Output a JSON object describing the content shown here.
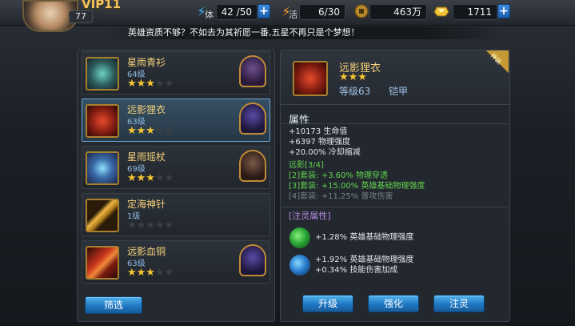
{
  "header": {
    "vip_label": "VIP11",
    "player_level": "77",
    "stamina": {
      "label": "体",
      "value": "42 /50"
    },
    "vitality": {
      "label": "活",
      "value": "6/30"
    },
    "gold": {
      "value": "463万"
    },
    "diamonds": {
      "value": "1711"
    }
  },
  "marquee": {
    "text": "英雄资质不够？不如去为其祈愿一番,五星不再只是个梦想！"
  },
  "items": [
    {
      "name": "星雨青衫",
      "level": "64级",
      "stars": 3,
      "max_stars": 5,
      "selected": false,
      "has_hero": true
    },
    {
      "name": "远影狸衣",
      "level": "63级",
      "stars": 3,
      "max_stars": 5,
      "selected": true,
      "has_hero": true
    },
    {
      "name": "星雨瑶杖",
      "level": "69级",
      "stars": 3,
      "max_stars": 5,
      "selected": false,
      "has_hero": true
    },
    {
      "name": "定海神针",
      "level": "1级",
      "stars": 0,
      "max_stars": 5,
      "selected": false,
      "has_hero": false
    },
    {
      "name": "远影血铜",
      "level": "63级",
      "stars": 3,
      "max_stars": 5,
      "selected": false,
      "has_hero": true
    }
  ],
  "filter_button": "筛选",
  "detail": {
    "name": "远影狸衣",
    "stars": 3,
    "level_text": "等级63",
    "type": "铠甲",
    "corner_tag": "神装",
    "attr_title": "属性",
    "base_stats": [
      "+10173 生命值",
      "+6397 物理强度",
      "+20.00% 冷却缩减"
    ],
    "set_title": "远影[3/4]",
    "set_bonuses": [
      {
        "text": "[2]套装: +3.60% 物理穿透",
        "active": true
      },
      {
        "text": "[3]套装: +15.00% 英雄基础物理强度",
        "active": true
      },
      {
        "text": "[4]套装: +11.25% 普攻伤害",
        "active": false
      }
    ],
    "infuse_title": "[注灵属性]",
    "infuse_1": [
      "+1.28% 英雄基础物理强度"
    ],
    "infuse_2": [
      "+1.92% 英雄基础物理强度",
      "+0.34% 技能伤害加成"
    ]
  },
  "actions": {
    "upgrade": "升级",
    "enhance": "强化",
    "infuse": "注灵"
  },
  "colors": {
    "accent_blue": "#2077c2",
    "gold_text": "#f7d27a",
    "set_green": "#61d34d",
    "star": "#f7c532"
  }
}
